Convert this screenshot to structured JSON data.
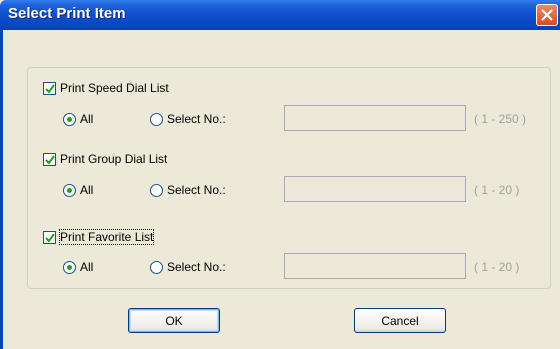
{
  "window": {
    "title": "Select Print Item"
  },
  "sections": [
    {
      "checkbox_label": "Print Speed Dial List",
      "checked": true,
      "radio_all": "All",
      "radio_select": "Select No.:",
      "selected": "All",
      "input_value": "",
      "range": "( 1 - 250 )"
    },
    {
      "checkbox_label": "Print Group Dial List",
      "checked": true,
      "radio_all": "All",
      "radio_select": "Select No.:",
      "selected": "All",
      "input_value": "",
      "range": "( 1 - 20 )"
    },
    {
      "checkbox_label": "Print Favorite List",
      "checked": true,
      "radio_all": "All",
      "radio_select": "Select No.:",
      "selected": "All",
      "input_value": "",
      "range": "( 1 - 20 )"
    }
  ],
  "buttons": {
    "ok": "OK",
    "cancel": "Cancel"
  },
  "colors": {
    "titlebar": "#0b47c4",
    "check_mark": "#21a121",
    "dialog_bg": "#ece9d8"
  }
}
